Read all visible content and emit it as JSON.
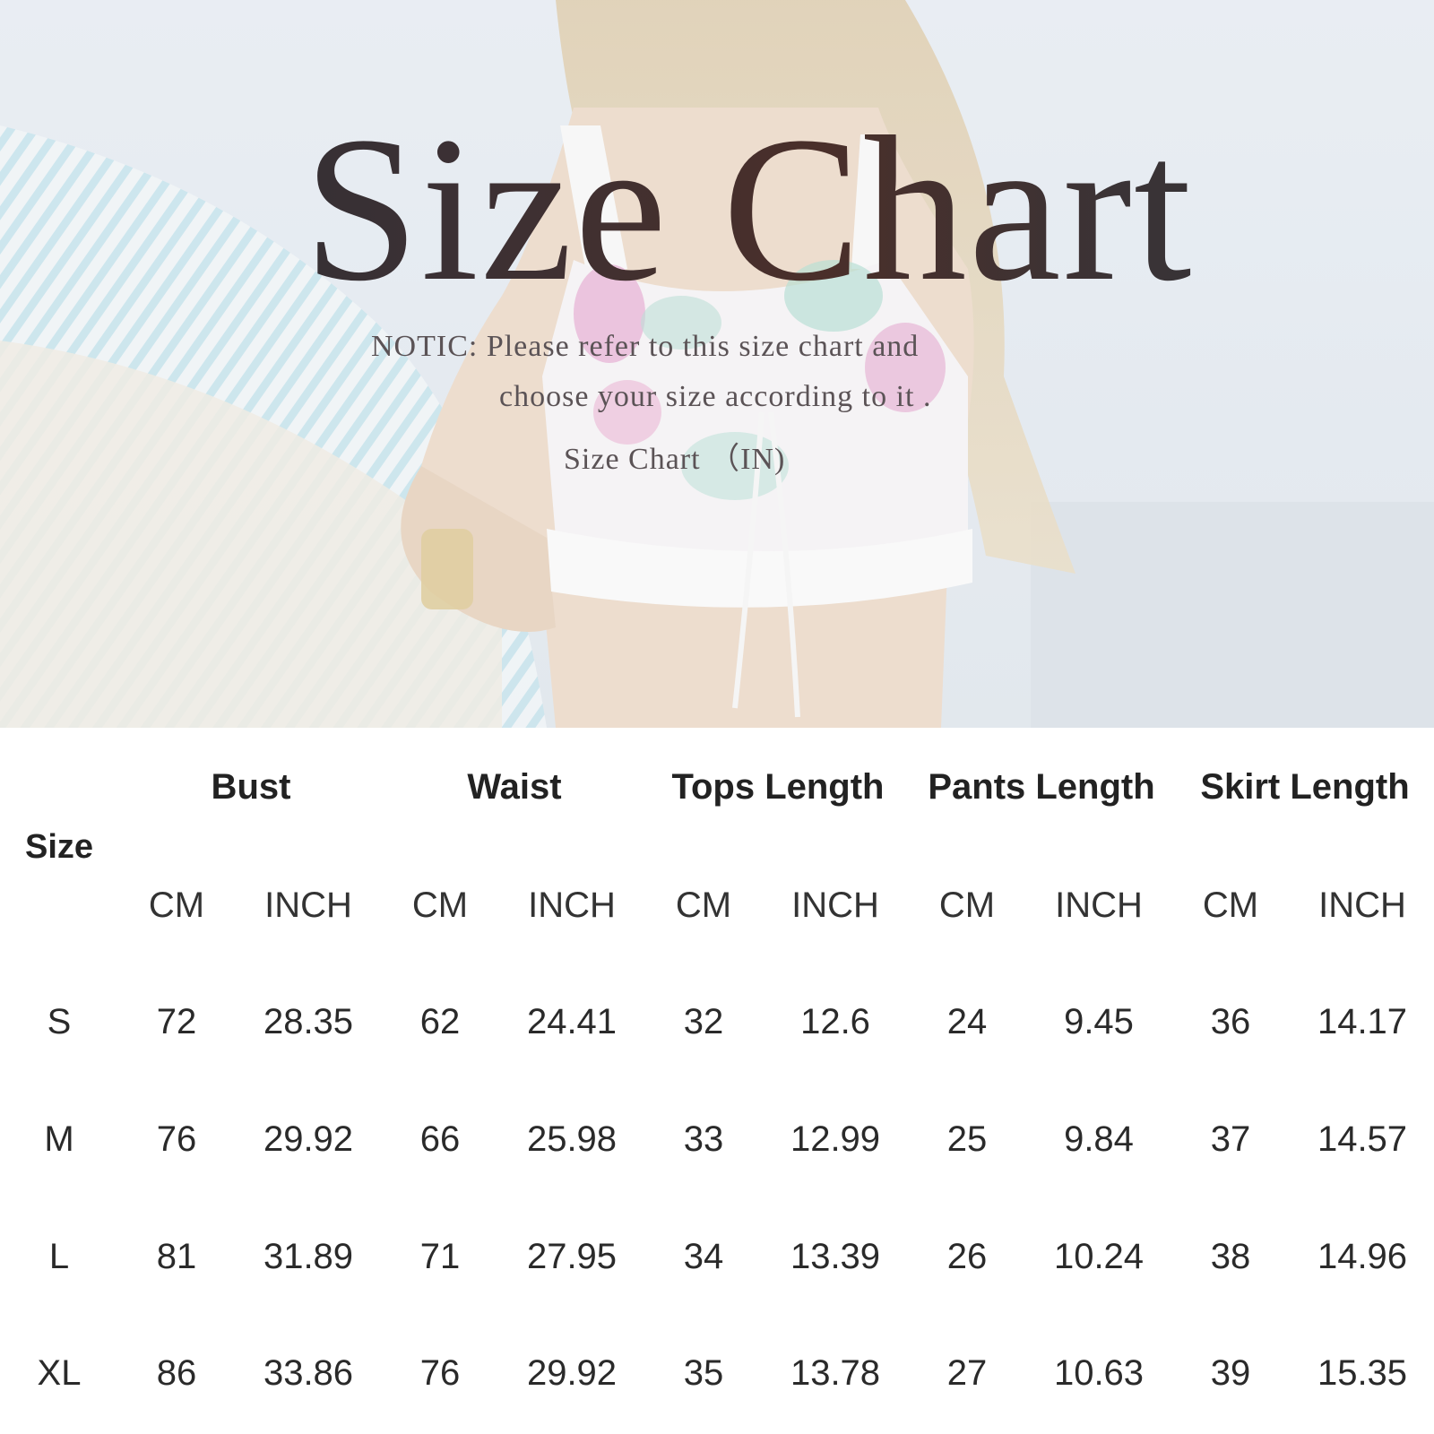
{
  "title": "Size Chart",
  "notice": {
    "line1": "NOTIC: Please refer to this size chart and",
    "line2": "choose your size according to it .",
    "line3": "Size Chart （IN)"
  },
  "table": {
    "size_header": "Size",
    "groups": [
      "Bust",
      "Waist",
      "Tops Length",
      "Pants Length",
      "Skirt Length"
    ],
    "units": [
      "CM",
      "INCH",
      "CM",
      "INCH",
      "CM",
      "INCH",
      "CM",
      "INCH",
      "CM",
      "INCH"
    ],
    "rows": [
      {
        "size": "S",
        "values": [
          "72",
          "28.35",
          "62",
          "24.41",
          "32",
          "12.6",
          "24",
          "9.45",
          "36",
          "14.17"
        ]
      },
      {
        "size": "M",
        "values": [
          "76",
          "29.92",
          "66",
          "25.98",
          "33",
          "12.99",
          "25",
          "9.84",
          "37",
          "14.57"
        ]
      },
      {
        "size": "L",
        "values": [
          "81",
          "31.89",
          "71",
          "27.95",
          "34",
          "13.39",
          "26",
          "10.24",
          "38",
          "14.96"
        ]
      },
      {
        "size": "XL",
        "values": [
          "86",
          "33.86",
          "76",
          "29.92",
          "35",
          "13.78",
          "27",
          "10.63",
          "39",
          "15.35"
        ]
      }
    ]
  }
}
